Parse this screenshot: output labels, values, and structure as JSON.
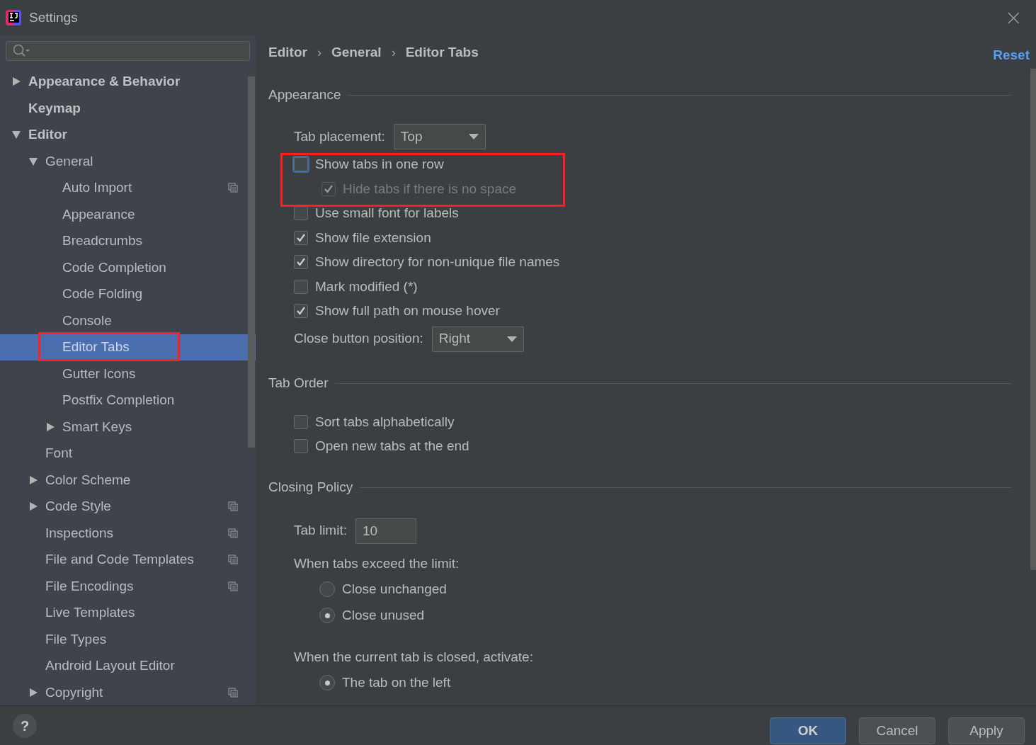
{
  "window": {
    "title": "Settings",
    "close": "×"
  },
  "sidebar": {
    "items": [
      {
        "label": "Appearance & Behavior",
        "expanded": false
      },
      {
        "label": "Keymap"
      },
      {
        "label": "Editor",
        "expanded": true,
        "children": [
          {
            "label": "General",
            "expanded": true,
            "children": [
              {
                "label": "Auto Import",
                "scoped": true
              },
              {
                "label": "Appearance"
              },
              {
                "label": "Breadcrumbs"
              },
              {
                "label": "Code Completion"
              },
              {
                "label": "Code Folding"
              },
              {
                "label": "Console"
              },
              {
                "label": "Editor Tabs",
                "selected": true,
                "highlighted": true
              },
              {
                "label": "Gutter Icons"
              },
              {
                "label": "Postfix Completion"
              },
              {
                "label": "Smart Keys",
                "expanded": false
              }
            ]
          },
          {
            "label": "Font"
          },
          {
            "label": "Color Scheme",
            "expanded": false
          },
          {
            "label": "Code Style",
            "expanded": false,
            "scoped": true
          },
          {
            "label": "Inspections",
            "scoped": true
          },
          {
            "label": "File and Code Templates",
            "scoped": true
          },
          {
            "label": "File Encodings",
            "scoped": true
          },
          {
            "label": "Live Templates"
          },
          {
            "label": "File Types"
          },
          {
            "label": "Android Layout Editor"
          },
          {
            "label": "Copyright",
            "expanded": false,
            "scoped": true
          }
        ]
      }
    ]
  },
  "breadcrumbs": [
    "Editor",
    "General",
    "Editor Tabs"
  ],
  "breadcrumb_separator": "›",
  "reset": "Reset",
  "sections": [
    {
      "title": "Appearance",
      "items": [
        {
          "kind": "dropdown",
          "label": "Tab placement:",
          "value": "Top"
        },
        {
          "kind": "checkbox",
          "label": "Show tabs in one row",
          "checked": false,
          "focused": true,
          "highlighted": true,
          "children": [
            {
              "kind": "checkbox",
              "label": "Hide tabs if there is no space",
              "checked": true,
              "disabled": true
            }
          ]
        },
        {
          "kind": "checkbox",
          "label": "Use small font for labels",
          "checked": false
        },
        {
          "kind": "checkbox",
          "label": "Show file extension",
          "checked": true
        },
        {
          "kind": "checkbox",
          "label": "Show directory for non-unique file names",
          "checked": true
        },
        {
          "kind": "checkbox",
          "label": "Mark modified (*)",
          "checked": false
        },
        {
          "kind": "checkbox",
          "label": "Show full path on mouse hover",
          "checked": true
        },
        {
          "kind": "dropdown",
          "label": "Close button position:",
          "value": "Right"
        }
      ]
    },
    {
      "title": "Tab Order",
      "items": [
        {
          "kind": "checkbox",
          "label": "Sort tabs alphabetically",
          "checked": false
        },
        {
          "kind": "checkbox",
          "label": "Open new tabs at the end",
          "checked": false
        }
      ]
    },
    {
      "title": "Closing Policy",
      "items": [
        {
          "kind": "field",
          "label": "Tab limit:",
          "value": "10"
        },
        {
          "kind": "label",
          "label": "When tabs exceed the limit:"
        },
        {
          "kind": "radio",
          "label": "Close unchanged",
          "selected": false
        },
        {
          "kind": "radio",
          "label": "Close unused",
          "selected": true
        },
        {
          "kind": "label",
          "label": "When the current tab is closed, activate:"
        },
        {
          "kind": "radio",
          "label": "The tab on the left",
          "selected": true
        }
      ]
    }
  ],
  "footer": {
    "help": "?",
    "buttons": [
      {
        "label": "OK",
        "primary": true
      },
      {
        "label": "Cancel",
        "primary": false
      },
      {
        "label": "Apply",
        "primary": false
      }
    ]
  }
}
